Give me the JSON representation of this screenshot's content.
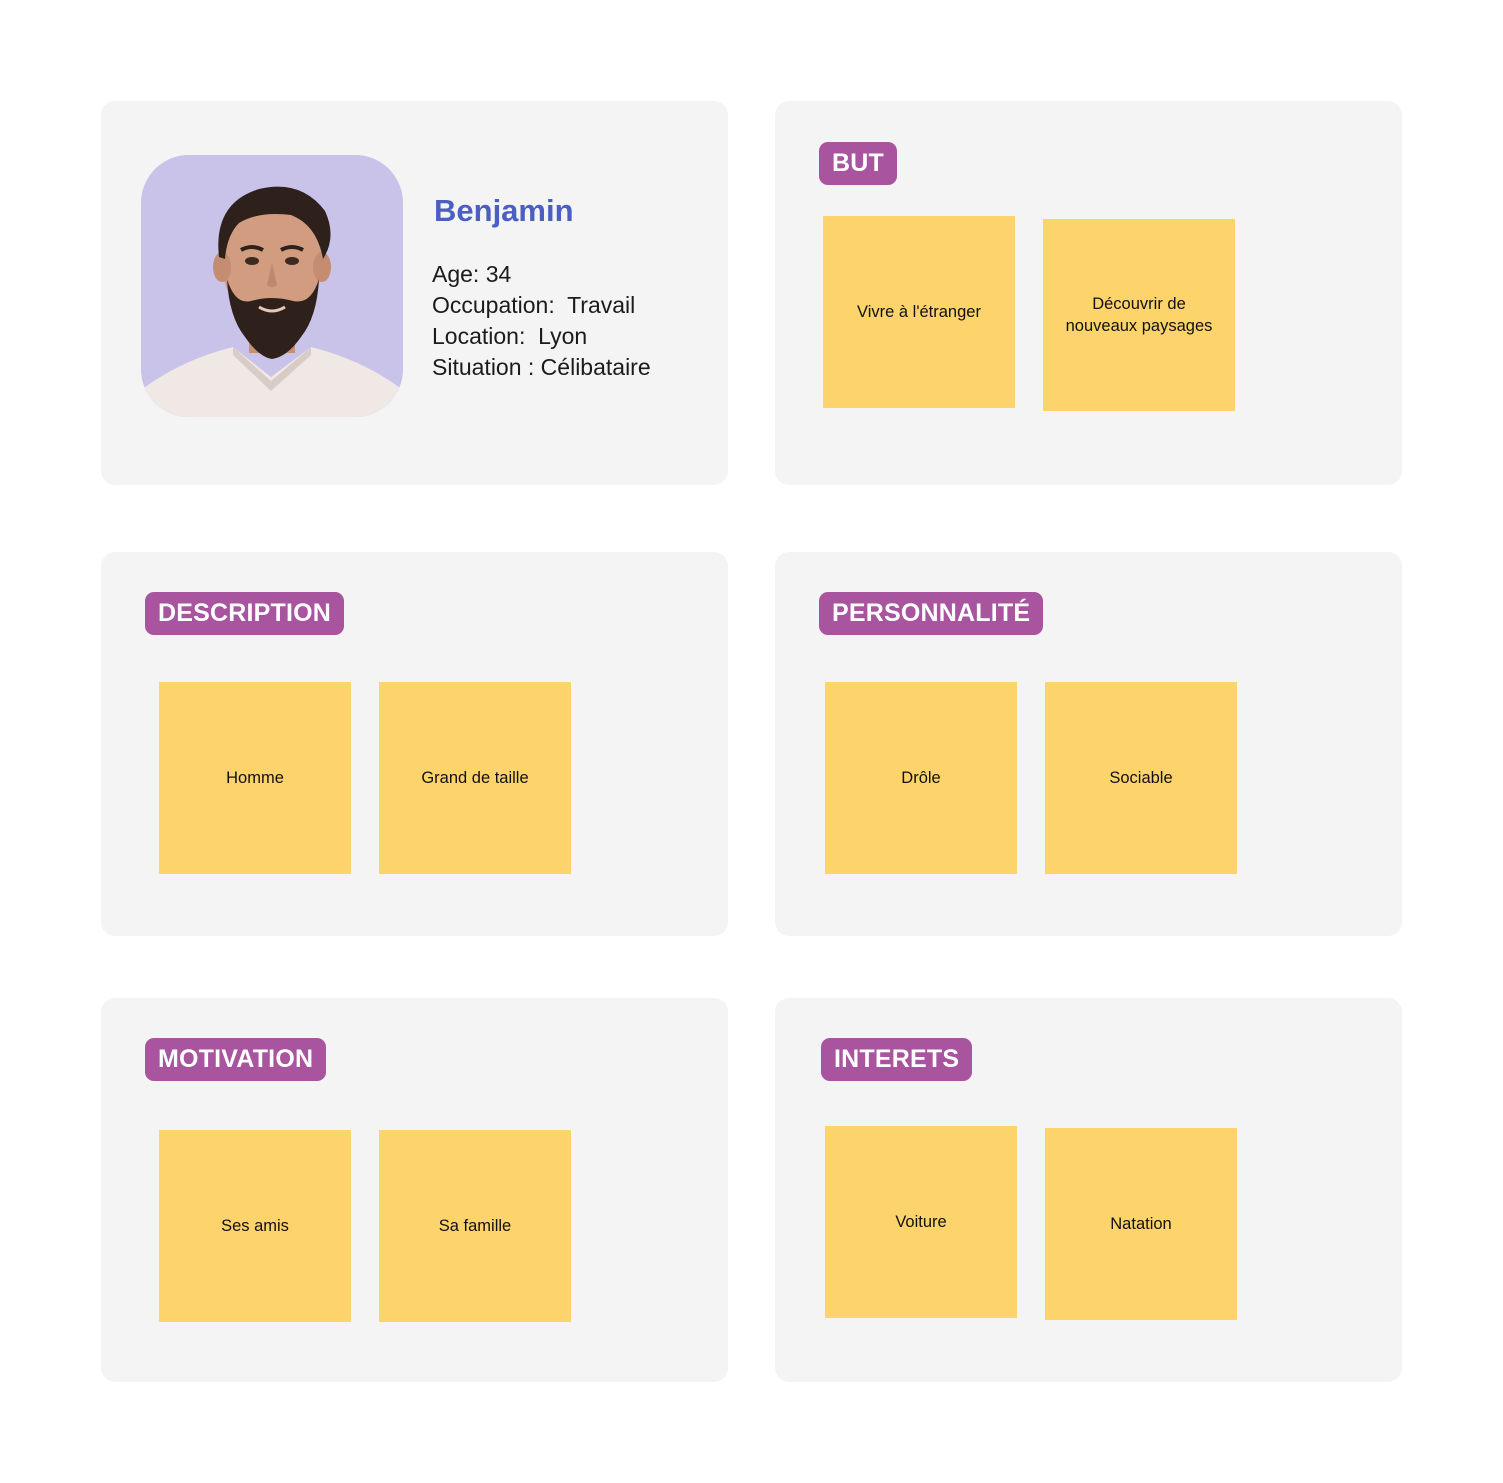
{
  "profile": {
    "name": "Benjamin",
    "age": "Age: 34",
    "occupation": "Occupation:  Travail",
    "location": "Location:  Lyon",
    "situation": "Situation : Célibataire"
  },
  "but": {
    "title": "BUT",
    "notes": [
      "Vivre à l'étranger",
      "Découvrir de nouveaux paysages"
    ]
  },
  "description": {
    "title": "DESCRIPTION",
    "notes": [
      "Homme",
      "Grand de taille"
    ]
  },
  "personnalite": {
    "title": "PERSONNALITÉ",
    "notes": [
      "Drôle",
      "Sociable"
    ]
  },
  "motivation": {
    "title": "MOTIVATION",
    "notes": [
      "Ses amis",
      "Sa famille"
    ]
  },
  "interets": {
    "title": "INTERETS",
    "notes": [
      "Voiture",
      "Natation"
    ]
  },
  "colors": {
    "badge": "#a8549e",
    "note": "#fdd46c",
    "card": "#f4f4f4",
    "name": "#4a5fc1"
  }
}
